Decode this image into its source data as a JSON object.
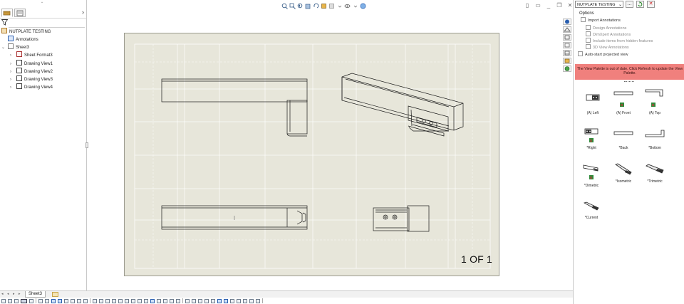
{
  "feature_tree": {
    "tabs": [
      "feature-manager",
      "property-manager"
    ],
    "root": "NUTPLATE TESTING",
    "items": [
      {
        "label": "Annotations",
        "icon": "annotations-icon"
      },
      {
        "label": "Sheet3",
        "icon": "sheet-icon"
      },
      {
        "label": "Sheet Format3",
        "icon": "sheet-format-icon"
      },
      {
        "label": "Drawing View1",
        "icon": "drawing-view-icon"
      },
      {
        "label": "Drawing View2",
        "icon": "drawing-view-icon"
      },
      {
        "label": "Drawing View3",
        "icon": "drawing-view-icon"
      },
      {
        "label": "Drawing View4",
        "icon": "drawing-view-icon"
      }
    ]
  },
  "drawing": {
    "sheet_number": "1 OF 1",
    "background": "#e7e6da"
  },
  "view_toolbar": [
    "zoom-to-fit-icon",
    "zoom-area-icon",
    "previous-view-icon",
    "section-view-icon",
    "rotate-icon",
    "display-style-icon",
    "hide-show-icon",
    "appearance-icon",
    "scene-icon"
  ],
  "task_pane": {
    "palette_select": "NUTPLATE TESTING",
    "options_title": "Options",
    "import_annotations": "Import Annotations",
    "design_annotations": "Design Annotations",
    "dimxpert_annotations": "DimXpert Annotations",
    "include_hidden": "Include items from hidden features",
    "view_3d_annotations": "3D View Annotations",
    "auto_projected": "Auto-start projected view",
    "warning": "The View Palette is out of date. Click Refresh to update the View Palette.",
    "palette_items": [
      {
        "label": "(A) Left"
      },
      {
        "label": "(A) Front"
      },
      {
        "label": "(A) Top"
      },
      {
        "label": "*Right"
      },
      {
        "label": "*Back"
      },
      {
        "label": "*Bottom"
      },
      {
        "label": "*Dimetric"
      },
      {
        "label": "*Isometric"
      },
      {
        "label": "*Trimetric"
      },
      {
        "label": "*Current"
      }
    ],
    "accent_warning": "#f0807d"
  },
  "sheet_tabs": {
    "active": "Sheet3"
  }
}
